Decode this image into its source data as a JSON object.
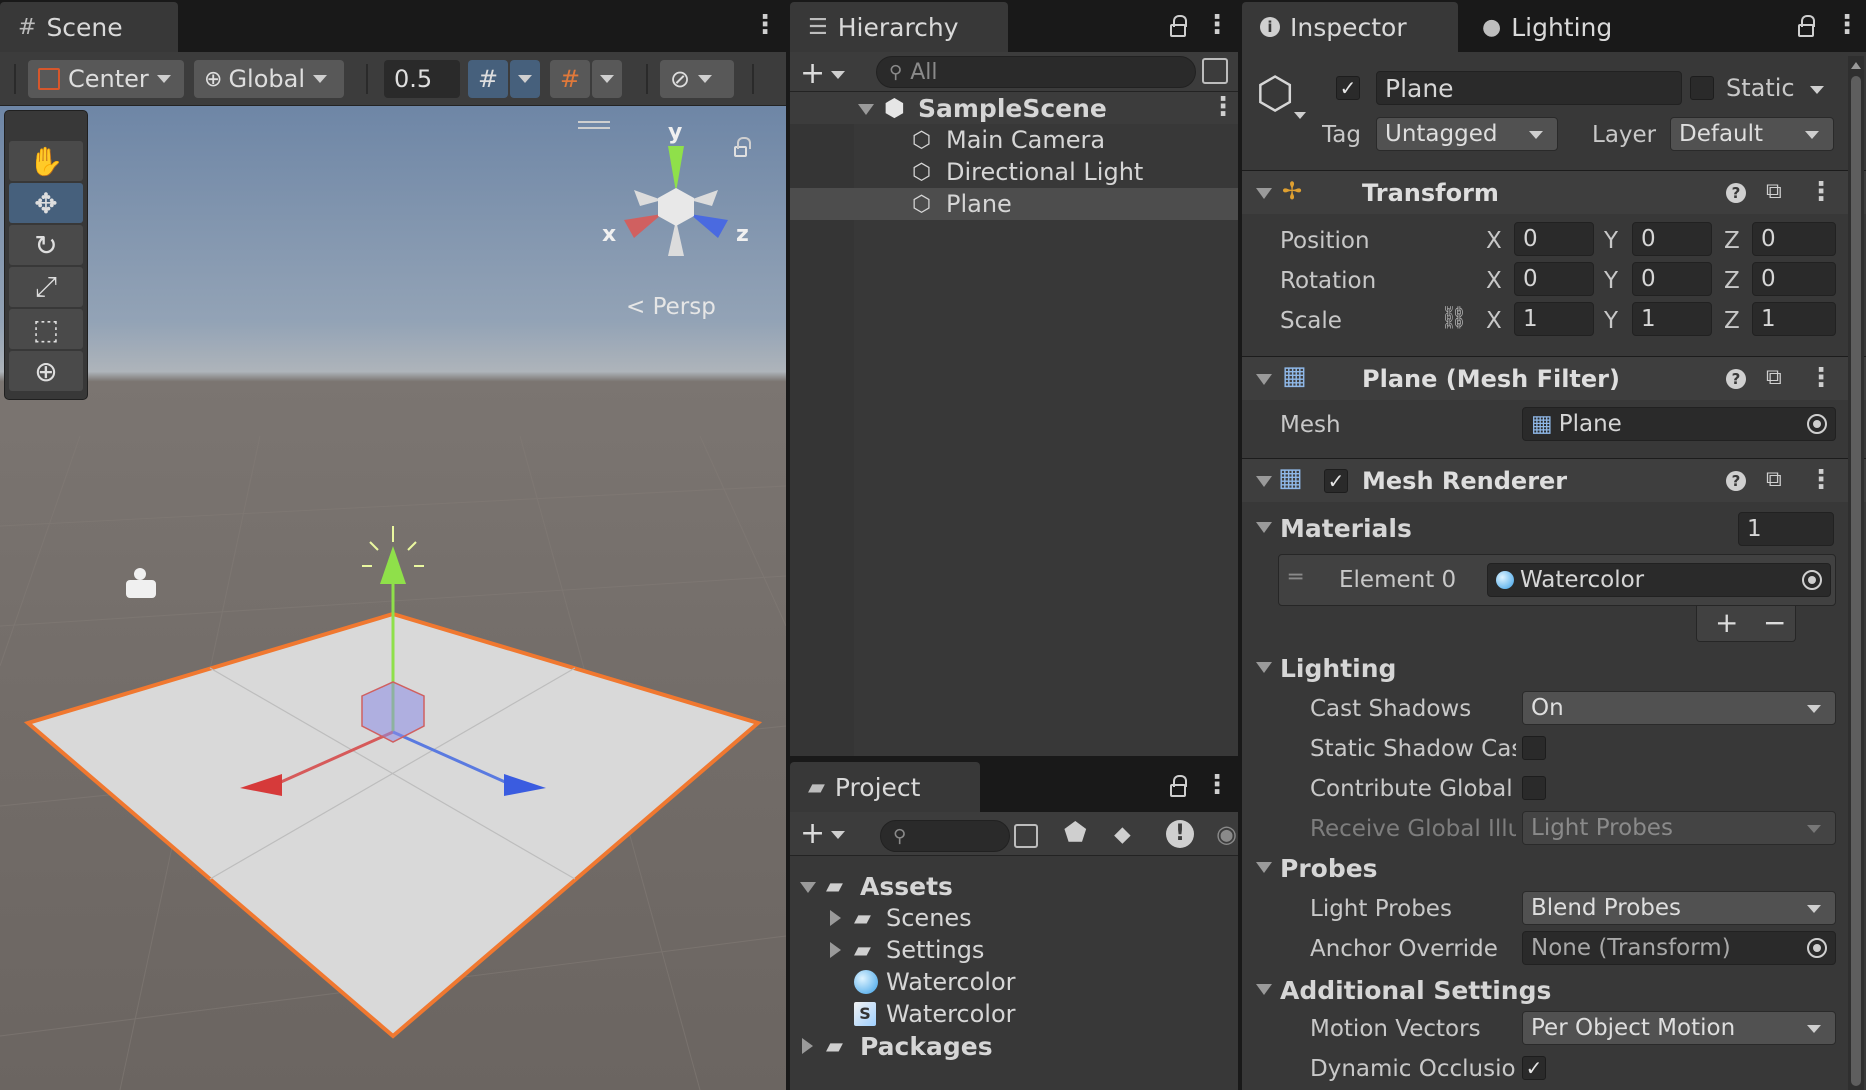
{
  "scene": {
    "tab": "Scene",
    "pivot": "Center",
    "space": "Global",
    "snap_value": "0.5",
    "persp_label": "Persp",
    "gizmo_axes": {
      "x": "x",
      "y": "y",
      "z": "z"
    },
    "tools": [
      "hand-tool",
      "move-tool",
      "rotate-tool",
      "scale-tool",
      "rect-tool",
      "transform-tool"
    ]
  },
  "hierarchy": {
    "tab": "Hierarchy",
    "search_placeholder": "All",
    "scene_name": "SampleScene",
    "objects": [
      "Main Camera",
      "Directional Light",
      "Plane"
    ],
    "selected": "Plane"
  },
  "project": {
    "tab": "Project",
    "root": "Assets",
    "items": [
      {
        "label": "Scenes",
        "type": "folder"
      },
      {
        "label": "Settings",
        "type": "folder"
      },
      {
        "label": "Watercolor",
        "type": "material"
      },
      {
        "label": "Watercolor",
        "type": "shader",
        "badge": "S"
      }
    ],
    "packages": "Packages"
  },
  "inspector": {
    "tab": "Inspector",
    "tab2": "Lighting",
    "object_name": "Plane",
    "static_label": "Static",
    "tag_label": "Tag",
    "tag_value": "Untagged",
    "layer_label": "Layer",
    "layer_value": "Default",
    "transform": {
      "title": "Transform",
      "position_label": "Position",
      "rotation_label": "Rotation",
      "scale_label": "Scale",
      "axis_x": "X",
      "axis_y": "Y",
      "axis_z": "Z",
      "position": [
        "0",
        "0",
        "0"
      ],
      "rotation": [
        "0",
        "0",
        "0"
      ],
      "scale": [
        "1",
        "1",
        "1"
      ]
    },
    "mesh_filter": {
      "title": "Plane (Mesh Filter)",
      "mesh_label": "Mesh",
      "mesh_value": "Plane"
    },
    "mesh_renderer": {
      "title": "Mesh Renderer",
      "materials_label": "Materials",
      "materials_count": "1",
      "element_label": "Element 0",
      "element_value": "Watercolor",
      "add": "+",
      "remove": "−"
    },
    "lighting": {
      "title": "Lighting",
      "cast_shadows_label": "Cast Shadows",
      "cast_shadows_value": "On",
      "static_shadow_label": "Static Shadow Cas",
      "contribute_label": "Contribute Global",
      "receive_label": "Receive Global Illu",
      "receive_value": "Light Probes"
    },
    "probes": {
      "title": "Probes",
      "light_probes_label": "Light Probes",
      "light_probes_value": "Blend Probes",
      "anchor_label": "Anchor Override",
      "anchor_value": "None (Transform)"
    },
    "additional": {
      "title": "Additional Settings",
      "motion_label": "Motion Vectors",
      "motion_value": "Per Object Motion",
      "occlusion_label": "Dynamic Occlusior"
    }
  },
  "colors": {
    "selection": "#46607c",
    "panel": "#383838",
    "x_axis": "#d63a3a",
    "y_axis": "#8fe04a",
    "z_axis": "#3a5ce0",
    "outline": "#f07830"
  }
}
